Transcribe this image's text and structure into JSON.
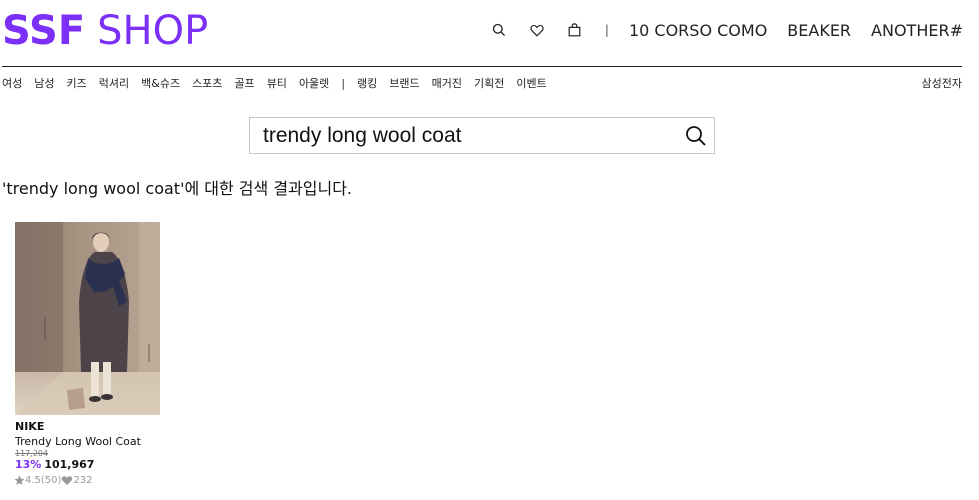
{
  "header": {
    "logo_bold": "SSF",
    "logo_thin": "SHOP",
    "icons": [
      "search-icon",
      "heart-icon",
      "bag-icon"
    ],
    "separator": "|",
    "brands": [
      "10 CORSO COMO",
      "BEAKER",
      "ANOTHER#"
    ]
  },
  "nav": {
    "items": [
      "여성",
      "남성",
      "키즈",
      "럭셔리",
      "백&슈즈",
      "스포츠",
      "골프",
      "뷰티",
      "아울렛"
    ],
    "separator": "|",
    "items2": [
      "랭킹",
      "브랜드",
      "매거진",
      "기획전",
      "이벤트"
    ],
    "right_item": "삼성전자"
  },
  "search": {
    "value": "trendy long wool coat",
    "button_icon": "search-icon"
  },
  "results": {
    "message": "'trendy long wool coat'에 대한 검색 결과입니다."
  },
  "products": [
    {
      "brand": "NIKE",
      "title": "Trendy Long Wool Coat",
      "original_price": "117,204",
      "discount": "13%",
      "price": "101,967",
      "rating": "4.5(50)",
      "likes": "232"
    }
  ],
  "colors": {
    "accent": "#7b2ff7"
  }
}
